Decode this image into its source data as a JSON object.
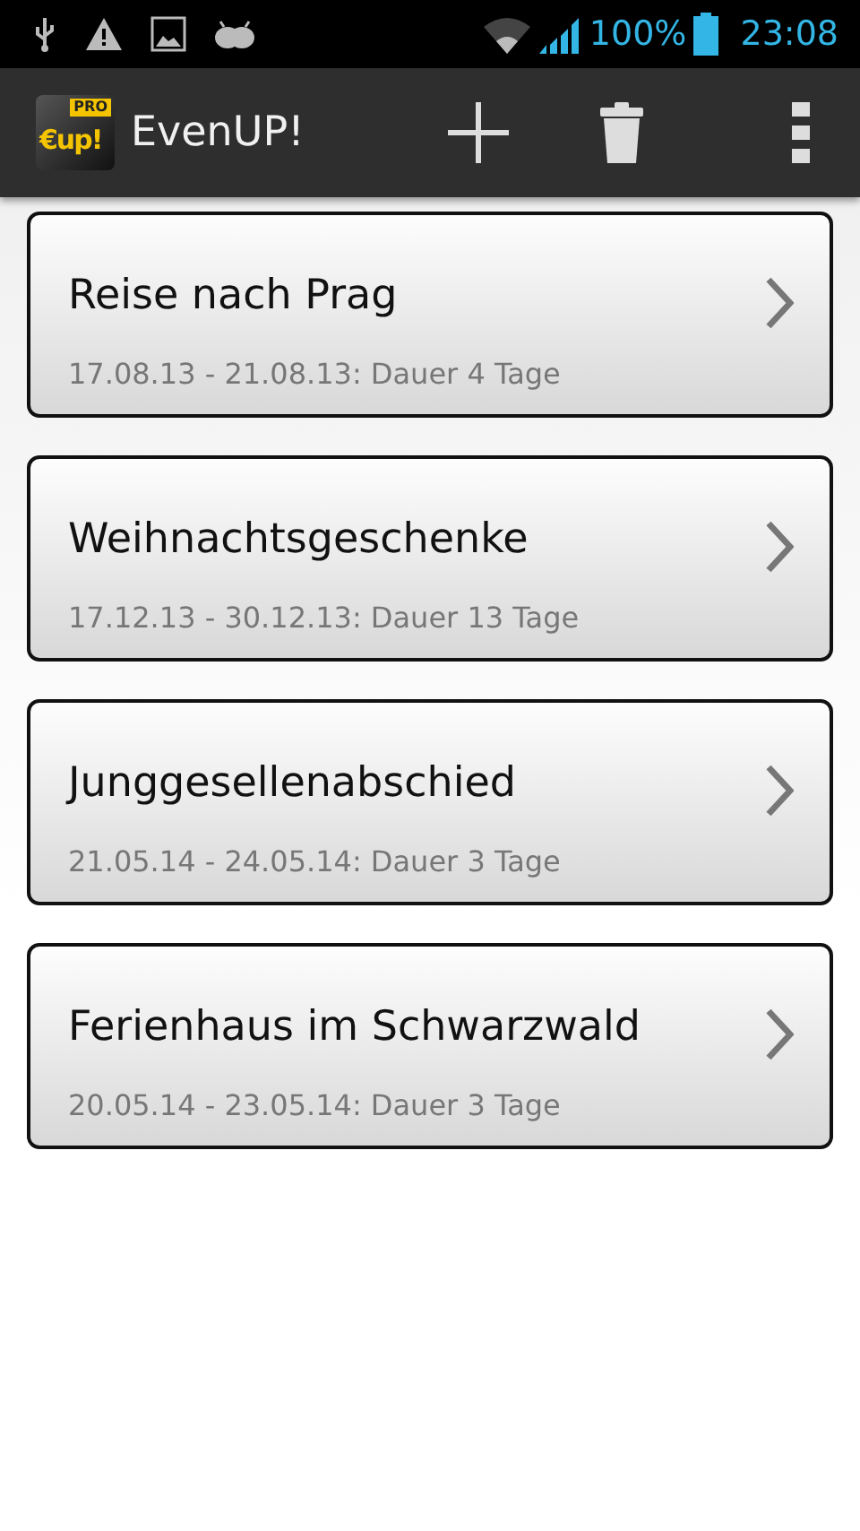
{
  "status_bar": {
    "battery": "100%",
    "time": "23:08"
  },
  "action_bar": {
    "logo": {
      "text": "€up!",
      "badge": "PRO"
    },
    "title": "EvenUP!"
  },
  "trips": [
    {
      "title": "Reise nach Prag",
      "subtitle": "17.08.13 - 21.08.13: Dauer 4 Tage"
    },
    {
      "title": "Weihnachtsgeschenke",
      "subtitle": "17.12.13 - 30.12.13: Dauer 13 Tage"
    },
    {
      "title": "Junggesellenabschied",
      "subtitle": "21.05.14 - 24.05.14: Dauer 3 Tage"
    },
    {
      "title": "Ferienhaus im Schwarzwald",
      "subtitle": "20.05.14 - 23.05.14: Dauer 3 Tage"
    }
  ]
}
